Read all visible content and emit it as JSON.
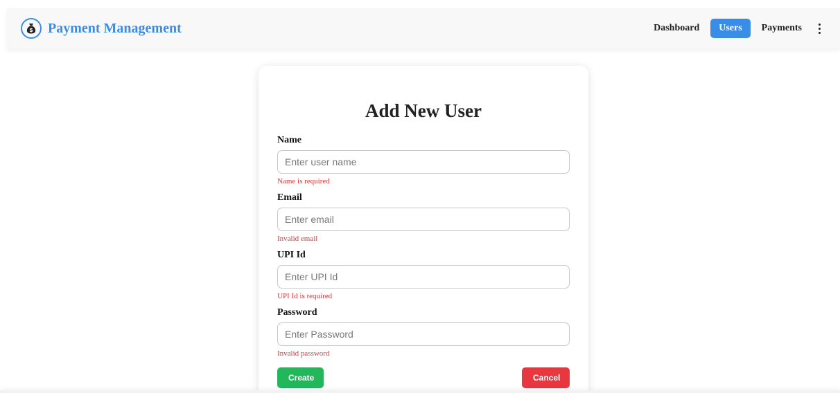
{
  "navbar": {
    "brand_title": "Payment Management",
    "brand_icon": "money-bag-icon",
    "accent_color": "#3a8de6",
    "links": [
      {
        "label": "Dashboard",
        "active": false
      },
      {
        "label": "Users",
        "active": true
      },
      {
        "label": "Payments",
        "active": false
      }
    ],
    "more_icon": "vertical-ellipsis-icon"
  },
  "form": {
    "title": "Add New User",
    "fields": {
      "name": {
        "label": "Name",
        "placeholder": "Enter user name",
        "value": "",
        "error": "Name is required"
      },
      "email": {
        "label": "Email",
        "placeholder": "Enter email",
        "value": "",
        "error": "Invalid email"
      },
      "upi": {
        "label": "UPI Id",
        "placeholder": "Enter UPI Id",
        "value": "",
        "error": "UPI Id is required"
      },
      "password": {
        "label": "Password",
        "placeholder": "Enter Password",
        "value": "",
        "error": "Invalid password"
      }
    },
    "create_label": "Create",
    "cancel_label": "Cancel",
    "error_color": "#e0363b",
    "create_color": "#21b75a",
    "cancel_color": "#e8373f"
  }
}
